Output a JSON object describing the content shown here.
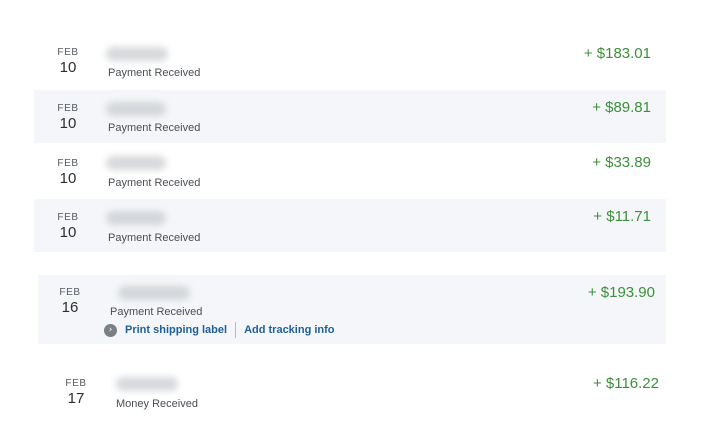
{
  "transactions": [
    {
      "month": "FEB",
      "day": "10",
      "status": "Payment Received",
      "amount": "+ $183.01",
      "name_blurred": true
    },
    {
      "month": "FEB",
      "day": "10",
      "status": "Payment Received",
      "amount": "+ $89.81",
      "name_blurred": true
    },
    {
      "month": "FEB",
      "day": "10",
      "status": "Payment Received",
      "amount": "+ $33.89",
      "name_blurred": true
    },
    {
      "month": "FEB",
      "day": "10",
      "status": "Payment Received",
      "amount": "+ $11.71",
      "name_blurred": true
    },
    {
      "month": "FEB",
      "day": "16",
      "status": "Payment Received",
      "amount": "+ $193.90",
      "name_blurred": true,
      "actions": {
        "print_label": "Print shipping label",
        "tracking": "Add tracking info"
      }
    },
    {
      "month": "FEB",
      "day": "17",
      "status": "Money Received",
      "amount": "+ $116.22",
      "name_blurred": true
    }
  ],
  "colors": {
    "amount": "#3d8f3b",
    "link": "#1f5f99",
    "row_shade": "#f4f6f9"
  },
  "icons": {
    "expand": "chevron-right-circle-icon"
  }
}
